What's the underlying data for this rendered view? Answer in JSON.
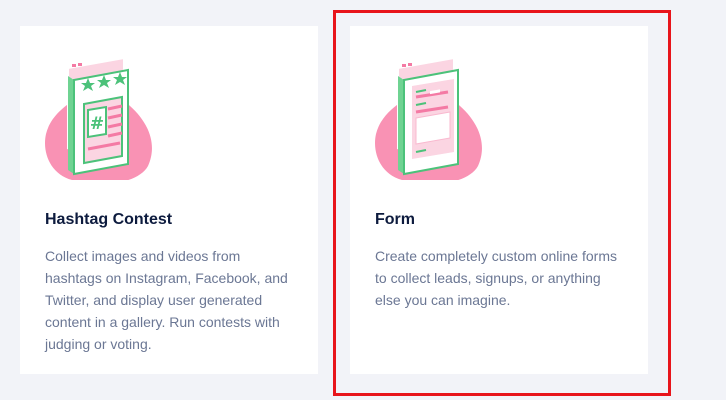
{
  "cards": [
    {
      "title": "Hashtag Contest",
      "description": "Collect images and videos from hashtags on Instagram, Facebook, and Twitter, and display user generated content in a gallery. Run contests with judging or voting.",
      "icon": "hashtag-contest-icon"
    },
    {
      "title": "Form",
      "description": "Create completely custom online forms to collect leads, signups, or anything else you can imagine.",
      "icon": "form-icon"
    }
  ],
  "highlight_color": "#e8141b",
  "colors": {
    "blob": "#f992b4",
    "green": "#4cc27a",
    "pink_light": "#fbd5e2",
    "title": "#0d1b3e",
    "text": "#6b7794"
  }
}
